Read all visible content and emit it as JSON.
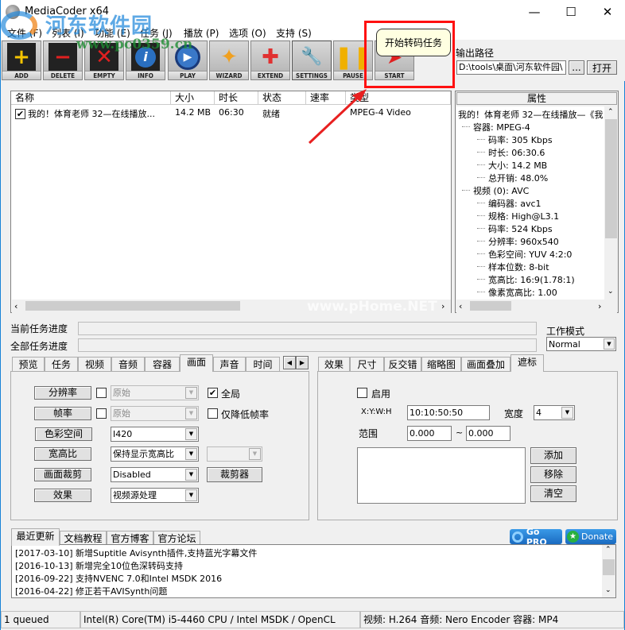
{
  "window": {
    "title": "MediaCoder x64",
    "controls": {
      "minimize": "—",
      "maximize": "☐",
      "close": "✕"
    }
  },
  "watermark": {
    "text1": "河东软件园",
    "text2": "www.pc0359.cn",
    "text3": "www.pHome.NET"
  },
  "menu": [
    {
      "label": "文件 (F)"
    },
    {
      "label": "列表 (I)"
    },
    {
      "label": "功能 (E)"
    },
    {
      "label": "任务 (J)"
    },
    {
      "label": "播放 (P)"
    },
    {
      "label": "选项 (O)"
    },
    {
      "label": "支持 (S)"
    }
  ],
  "toolbar": {
    "buttons": [
      {
        "label": "ADD",
        "icon": "add-icon",
        "glyph": "+"
      },
      {
        "label": "DELETE",
        "icon": "delete-icon",
        "glyph": "−"
      },
      {
        "label": "EMPTY",
        "icon": "empty-icon",
        "glyph": "✕"
      },
      {
        "label": "INFO",
        "icon": "info-icon",
        "glyph": "i"
      },
      {
        "label": "PLAY",
        "icon": "play-icon",
        "glyph": "▶"
      },
      {
        "label": "WIZARD",
        "icon": "wizard-icon",
        "glyph": "✦"
      },
      {
        "label": "EXTEND",
        "icon": "extend-icon",
        "glyph": "✚"
      },
      {
        "label": "SETTINGS",
        "icon": "settings-icon",
        "glyph": "🔧"
      },
      {
        "label": "PAUSE",
        "icon": "pause-icon",
        "glyph": "❚❚"
      },
      {
        "label": "START",
        "icon": "start-icon",
        "glyph": "➤"
      }
    ],
    "tooltip": "开始转码任务",
    "output_path_label": "输出路径",
    "output_path_value": "D:\\tools\\桌面\\河东软件园\\",
    "browse_label": "...",
    "open_label": "打开"
  },
  "file_list": {
    "columns": [
      "名称",
      "大小",
      "时长",
      "状态",
      "速率",
      "类型"
    ],
    "rows": [
      {
        "checked": true,
        "name": "我的！体育老师 32—在线播放...",
        "size": "14.2 MB",
        "duration": "06:30",
        "status": "就绪",
        "rate": "",
        "type": "MPEG-4 Video"
      }
    ]
  },
  "properties": {
    "header": "属性",
    "tree": [
      {
        "level": 0,
        "text": "我的！体育老师 32—在线播放—《我"
      },
      {
        "level": 1,
        "text": "容器: MPEG-4"
      },
      {
        "level": 2,
        "text": "码率: 305 Kbps"
      },
      {
        "level": 2,
        "text": "时长: 06:30.6"
      },
      {
        "level": 2,
        "text": "大小: 14.2 MB"
      },
      {
        "level": 2,
        "text": "总开销: 48.0%"
      },
      {
        "level": 1,
        "text": "视频 (0): AVC"
      },
      {
        "level": 2,
        "text": "编码器: avc1"
      },
      {
        "level": 2,
        "text": "规格: High@L3.1"
      },
      {
        "level": 2,
        "text": "码率: 524 Kbps"
      },
      {
        "level": 2,
        "text": "分辨率: 960x540"
      },
      {
        "level": 2,
        "text": "色彩空间: YUV 4:2:0"
      },
      {
        "level": 2,
        "text": "样本位数: 8-bit"
      },
      {
        "level": 2,
        "text": "宽高比: 16:9(1.78:1)"
      },
      {
        "level": 2,
        "text": "像素宽高比: 1.00"
      }
    ]
  },
  "progress": {
    "current_label": "当前任务进度",
    "current_value": 0,
    "total_label": "全部任务进度",
    "total_value": 0,
    "work_mode_label": "工作模式",
    "work_mode_value": "Normal"
  },
  "left_tabs": {
    "tabs": [
      "预览",
      "任务",
      "视频",
      "音频",
      "容器",
      "画面",
      "声音",
      "时间"
    ],
    "selected": "画面",
    "scroll_left": "◀",
    "scroll_right": "▶",
    "rows": [
      {
        "button": "分辨率",
        "has_check": true,
        "checked": false,
        "combo": "原始",
        "combo_disabled": true,
        "extra_check_label": "全局",
        "extra_checked": true
      },
      {
        "button": "帧率",
        "has_check": true,
        "checked": false,
        "combo": "原始",
        "combo_disabled": true,
        "extra_check_label": "仅降低帧率",
        "extra_checked": false
      },
      {
        "button": "色彩空间",
        "combo": "I420"
      },
      {
        "button": "宽高比",
        "combo": "保持显示宽高比",
        "extra_combo": ""
      },
      {
        "button": "画面裁剪",
        "combo": "Disabled",
        "extra_button": "裁剪器"
      },
      {
        "button": "效果",
        "combo": "视频源处理"
      }
    ]
  },
  "right_tabs": {
    "tabs": [
      "效果",
      "尺寸",
      "反交错",
      "缩略图",
      "画面叠加",
      "遮标"
    ],
    "selected": "遮标",
    "enable_label": "启用",
    "enable_checked": false,
    "xywh_label": "X:Y:W:H",
    "xywh_value": "10:10:50:50",
    "width_label": "宽度",
    "width_value": "4",
    "range_label": "范围",
    "range_from": "0.000",
    "range_sep": "~",
    "range_to": "0.000",
    "add_label": "添加",
    "remove_label": "移除",
    "clear_label": "清空"
  },
  "news": {
    "tabs": [
      "最近更新",
      "文档教程",
      "官方博客",
      "官方论坛"
    ],
    "selected": "最近更新",
    "gopro_label": "Go PRO",
    "donate_label": "Donate",
    "items": [
      "[2017-03-10] 新增Suptitle Avisynth插件,支持蓝光字幕文件",
      "[2016-10-13] 新增完全10位色深转码支持",
      "[2016-09-22] 支持NVENC 7.0和Intel MSDK 2016",
      "[2016-04-22] 修正若干AVISynth问题"
    ]
  },
  "statusbar": {
    "queue": "1 queued",
    "hardware": "Intel(R) Core(TM) i5-4460 CPU  / Intel MSDK / OpenCL",
    "codecs": "视频: H.264  音频: Nero Encoder  容器: MP4"
  },
  "colors": {
    "highlight": "#ff1010",
    "tooltip_bg": "#ffffe1",
    "window_border": "#1883d7"
  }
}
